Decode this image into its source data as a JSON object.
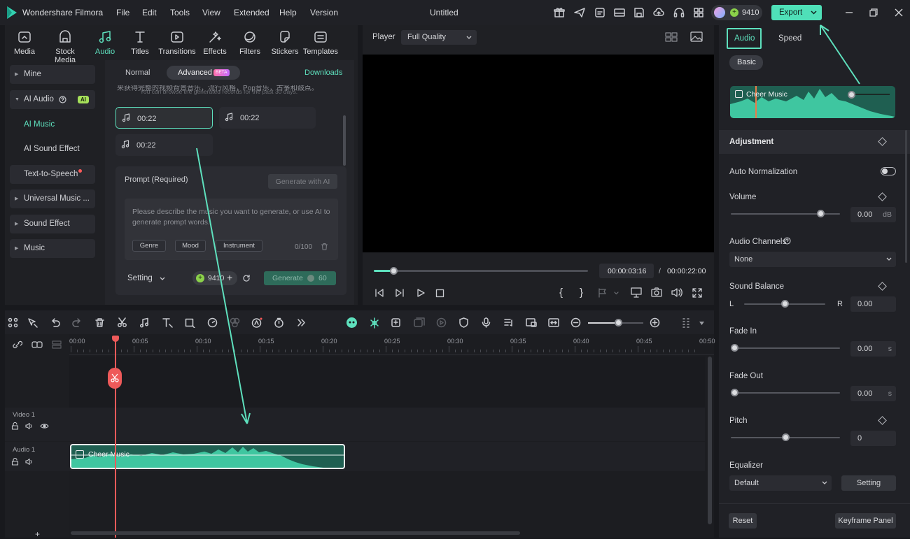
{
  "app": {
    "name": "Wondershare Filmora",
    "project_title": "Untitled",
    "credits": "9410",
    "export_label": "Export"
  },
  "menu": [
    "File",
    "Edit",
    "Tools",
    "View",
    "Extended",
    "Help",
    "Version"
  ],
  "media_tabs": [
    "Media",
    "Stock Media",
    "Audio",
    "Titles",
    "Transitions",
    "Effects",
    "Filters",
    "Stickers",
    "Templates"
  ],
  "sidebar": {
    "mine": "Mine",
    "ai_audio": "AI Audio",
    "ai_badge": "AI",
    "ai_music": "AI Music",
    "ai_sound_effect": "AI Sound Effect",
    "tts": "Text-to-Speech",
    "universal": "Universal Music ...",
    "sound_effect": "Sound Effect",
    "music": "Music"
  },
  "ai_music": {
    "mode_normal": "Normal",
    "mode_advanced": "Advanced",
    "beta": "BETA",
    "downloads": "Downloads",
    "notice_cn": "来获得完整的视频背景音乐，流行风格，Pop音乐，古筝和鼓点。",
    "notice": "You can browse the generated records for the past 30 days.",
    "clips": [
      "00:22",
      "00:22",
      "00:22"
    ],
    "prompt_label": "Prompt (Required)",
    "generate_ai": "Generate with AI",
    "prompt_placeholder": "Please describe the music you want to generate, or use AI to generate prompt words.",
    "chips": [
      "Genre",
      "Mood",
      "Instrument"
    ],
    "counter": "0/100",
    "setting": "Setting",
    "credits": "9410",
    "generate": "Generate",
    "generate_cost": "60"
  },
  "player": {
    "label": "Player",
    "quality": "Full Quality",
    "current_time": "00:00:03:16",
    "separator": "/",
    "total_time": "00:00:22:00",
    "progress": 0.09
  },
  "timeline": {
    "ruler": [
      "00:00",
      "00:05",
      "00:10",
      "00:15",
      "00:20",
      "00:25",
      "00:30",
      "00:35",
      "00:40",
      "00:45",
      "00:50"
    ],
    "video_track": "Video 1",
    "audio_track": "Audio 1",
    "audio_clip": "Cheer Music",
    "zoom": 0.55
  },
  "props": {
    "tab_audio": "Audio",
    "tab_speed": "Speed",
    "basic": "Basic",
    "clip_name": "Cheer Music",
    "adjustment": "Adjustment",
    "auto_normalization": "Auto Normalization",
    "volume": "Volume",
    "volume_value": "0.00",
    "volume_unit": "dB",
    "volume_level": 0.82,
    "audio_channels": "Audio Channels",
    "channels_value": "None",
    "sound_balance": "Sound Balance",
    "balance_left": "L",
    "balance_right": "R",
    "balance_value": "0.00",
    "balance_level": 0.5,
    "fade_in": "Fade In",
    "fade_in_value": "0.00",
    "fade_out": "Fade Out",
    "fade_out_value": "0.00",
    "fade_unit": "s",
    "pitch": "Pitch",
    "pitch_value": "0",
    "pitch_level": 0.5,
    "equalizer": "Equalizer",
    "eq_value": "Default",
    "eq_setting": "Setting",
    "reset": "Reset",
    "keyframe": "Keyframe Panel"
  },
  "colors": {
    "accent": "#5ee0bd",
    "playhead": "#ee5a5a",
    "bg": "#18191d",
    "panel": "#222328"
  }
}
